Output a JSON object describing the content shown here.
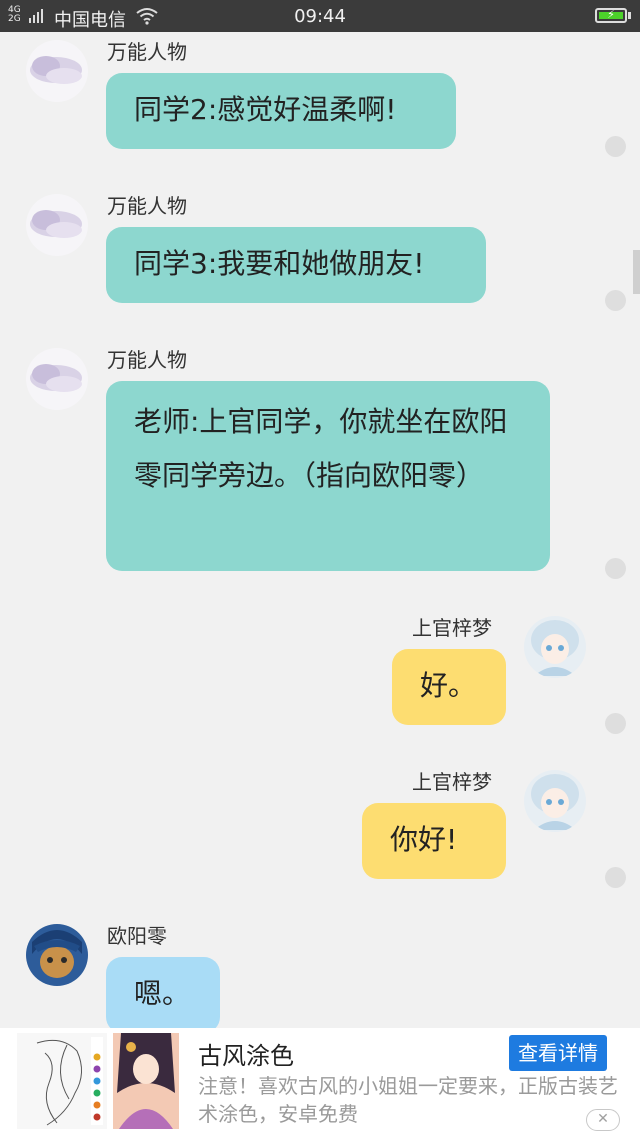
{
  "status_bar": {
    "network_top": "4G",
    "network_bottom": "2G",
    "carrier": "中国电信",
    "time": "09:44",
    "battery_icon": "battery-charging-icon",
    "battery_color": "#4cd12a"
  },
  "messages": [
    {
      "sender": "万能人物",
      "text": "同学2:感觉好温柔啊!",
      "side": "left",
      "bubble_color": "#8dd7cf"
    },
    {
      "sender": "万能人物",
      "text": "同学3:我要和她做朋友!",
      "side": "left",
      "bubble_color": "#8dd7cf"
    },
    {
      "sender": "万能人物",
      "text": "老师:上官同学，你就坐在欧阳零同学旁边。（指向欧阳零）",
      "side": "left",
      "bubble_color": "#8dd7cf"
    },
    {
      "sender": "上官梓梦",
      "text": "好。",
      "side": "right",
      "bubble_color": "#fddd71"
    },
    {
      "sender": "上官梓梦",
      "text": "你好!",
      "side": "right",
      "bubble_color": "#fddd71"
    },
    {
      "sender": "欧阳零",
      "text": "嗯。",
      "side": "left",
      "bubble_color": "#a9dcf6"
    }
  ],
  "ad": {
    "title": "古风涂色",
    "button": "查看详情",
    "description": "注意！喜欢古风的小姐姐一定要来，正版古装艺术涂色，安卓免费",
    "close_icon": "close-icon",
    "button_color": "#1e7be0"
  }
}
